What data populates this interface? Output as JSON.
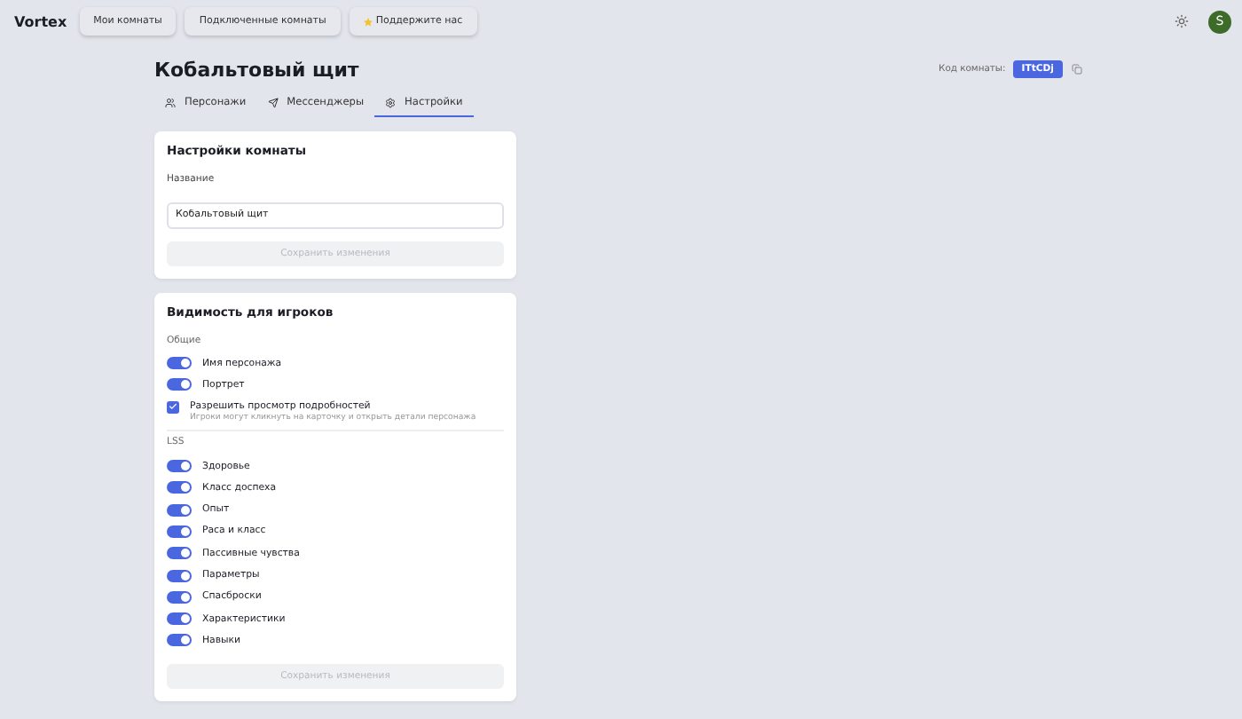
{
  "brand": "Vortex",
  "nav": [
    {
      "label": "Мои комнаты",
      "kind": "plain"
    },
    {
      "label": "Подключенные комнаты",
      "kind": "plain"
    },
    {
      "label": "Поддержите нас",
      "kind": "support"
    }
  ],
  "user": {
    "initial": "S"
  },
  "room": {
    "title": "Кобальтовый щит",
    "code_label": "Код комнаты:",
    "code": "ITtCDj"
  },
  "tabs": [
    {
      "label": "Персонажи",
      "kind": "users",
      "selected": false
    },
    {
      "label": "Мессенджеры",
      "kind": "send",
      "selected": false
    },
    {
      "label": "Настройки",
      "kind": "gear",
      "selected": true
    }
  ],
  "settings_card": {
    "title": "Настройки комнаты",
    "field_label": "Название",
    "field_value": "Кобальтовый щит",
    "save": "Сохранить изменения",
    "save_disabled": true
  },
  "visibility_card": {
    "title": "Видимость для игроков",
    "save": "Сохранить изменения",
    "save_disabled": true,
    "sections": [
      {
        "title": "Общие",
        "items": [
          {
            "kind": "toggle",
            "label": "Имя персонажа",
            "on": true
          },
          {
            "kind": "toggle",
            "label": "Портрет",
            "on": true
          },
          {
            "kind": "checkbox",
            "label": "Разрешить просмотр подробностей",
            "hint": "Игроки могут кликнуть на карточку и открыть детали персонажа",
            "checked": true
          }
        ]
      },
      {
        "title": "LSS",
        "items": [
          {
            "kind": "toggle",
            "label": "Здоровье",
            "on": true
          },
          {
            "kind": "toggle",
            "label": "Класс доспеха",
            "on": true
          },
          {
            "kind": "toggle",
            "label": "Опыт",
            "on": true
          },
          {
            "kind": "toggle",
            "label": "Раса и класс",
            "on": true
          },
          {
            "kind": "toggle",
            "label": "Пассивные чувства",
            "on": true
          },
          {
            "kind": "toggle",
            "label": "Параметры",
            "on": true
          },
          {
            "kind": "toggle",
            "label": "Спасброски",
            "on": true
          },
          {
            "kind": "toggle",
            "label": "Характеристики",
            "on": true
          },
          {
            "kind": "toggle",
            "label": "Навыки",
            "on": true
          }
        ]
      }
    ]
  }
}
